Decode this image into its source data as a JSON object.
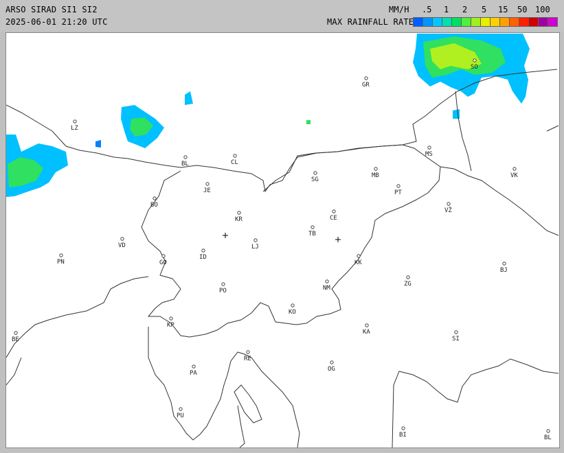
{
  "header": {
    "title": "ARSO SIRAD SI1 SI2",
    "datetime": "2025-06-01 21:20 UTC",
    "unit": "MM/H",
    "legend_label": "MAX RAINFALL RATE",
    "scale_ticks": [
      ".5",
      "1",
      "2",
      "5",
      "15",
      "50",
      "100"
    ],
    "scale_colors": [
      "#0060ff",
      "#0096ff",
      "#00c8ff",
      "#00e0b0",
      "#00e060",
      "#50f040",
      "#a0f020",
      "#e8f000",
      "#ffd000",
      "#ffa000",
      "#ff6000",
      "#ff2000",
      "#d00000",
      "#a000a0",
      "#d000d0"
    ]
  },
  "map": {
    "cities": [
      {
        "code": "GR"
      },
      {
        "code": "SO"
      },
      {
        "code": "LZ"
      },
      {
        "code": "BL"
      },
      {
        "code": "CL"
      },
      {
        "code": "MS"
      },
      {
        "code": "MB"
      },
      {
        "code": "SG"
      },
      {
        "code": "JE"
      },
      {
        "code": "PT"
      },
      {
        "code": "VK"
      },
      {
        "code": "BO"
      },
      {
        "code": "KR"
      },
      {
        "code": "CE"
      },
      {
        "code": "VŽ"
      },
      {
        "code": "TB"
      },
      {
        "code": "VD"
      },
      {
        "code": "LJ"
      },
      {
        "code": "PN"
      },
      {
        "code": "ID"
      },
      {
        "code": "GO"
      },
      {
        "code": "KK"
      },
      {
        "code": "BJ"
      },
      {
        "code": "ZG"
      },
      {
        "code": "PO"
      },
      {
        "code": "NM"
      },
      {
        "code": "KO"
      },
      {
        "code": "KP"
      },
      {
        "code": "KA"
      },
      {
        "code": "SI"
      },
      {
        "code": "BE"
      },
      {
        "code": "RE"
      },
      {
        "code": "PA"
      },
      {
        "code": "OG"
      },
      {
        "code": "PU"
      },
      {
        "code": "BI"
      },
      {
        "code": "BL"
      }
    ],
    "radar_sites": [
      "radar-site-lisca",
      "radar-site-pasja-ravan"
    ]
  }
}
